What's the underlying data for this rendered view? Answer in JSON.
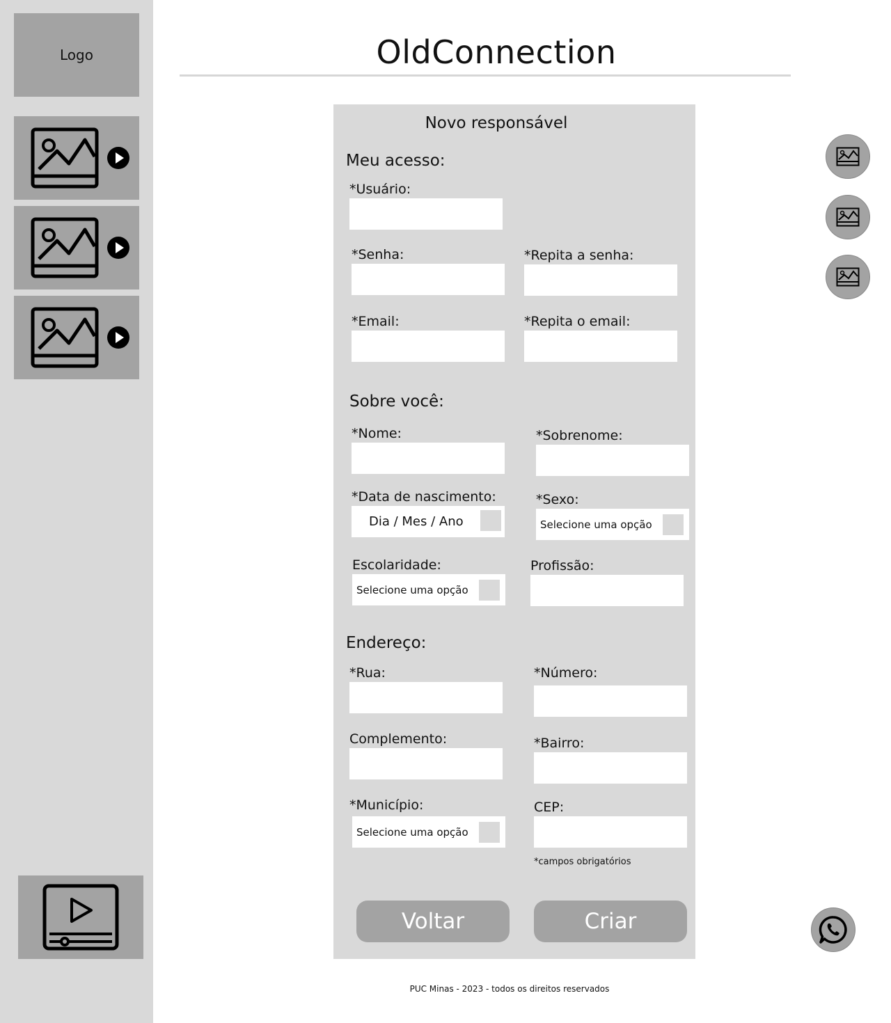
{
  "sidebar": {
    "logo": "Logo",
    "media_cards": [
      {
        "icon": "image-icon",
        "action_icon": "play-icon"
      },
      {
        "icon": "image-icon",
        "action_icon": "play-icon"
      },
      {
        "icon": "image-icon",
        "action_icon": "play-icon"
      }
    ],
    "video_icon": "video-player-icon"
  },
  "header": {
    "title": "OldConnection"
  },
  "form": {
    "title": "Novo responsável",
    "access": {
      "heading": "Meu acesso:",
      "user_label": "*Usuário:",
      "password_label": "*Senha:",
      "password_repeat_label": "*Repita a senha:",
      "email_label": "*Email:",
      "email_repeat_label": "*Repita o email:"
    },
    "about": {
      "heading": "Sobre você:",
      "first_name_label": "*Nome:",
      "last_name_label": "*Sobrenome:",
      "birth_label": "*Data de nascimento:",
      "birth_placeholder": "Dia / Mes / Ano",
      "sex_label": "*Sexo:",
      "sex_select": "Selecione uma opção",
      "education_label": "Escolaridade:",
      "education_select": "Selecione uma opção",
      "profession_label": "Profissão:"
    },
    "address": {
      "heading": "Endereço:",
      "street_label": "*Rua:",
      "number_label": "*Número:",
      "complement_label": "Complemento:",
      "district_label": "*Bairro:",
      "city_label": "*Município:",
      "city_select": "Selecione uma opção",
      "zip_label": "CEP:"
    },
    "required_note": "*campos obrigatórios",
    "back_button": "Voltar",
    "create_button": "Criar"
  },
  "right_rail": {
    "icons": [
      "image-icon",
      "image-icon",
      "image-icon"
    ],
    "chat_icon": "whatsapp-icon"
  },
  "footer": {
    "text": "PUC Minas - 2023 - todos os direitos reservados"
  }
}
